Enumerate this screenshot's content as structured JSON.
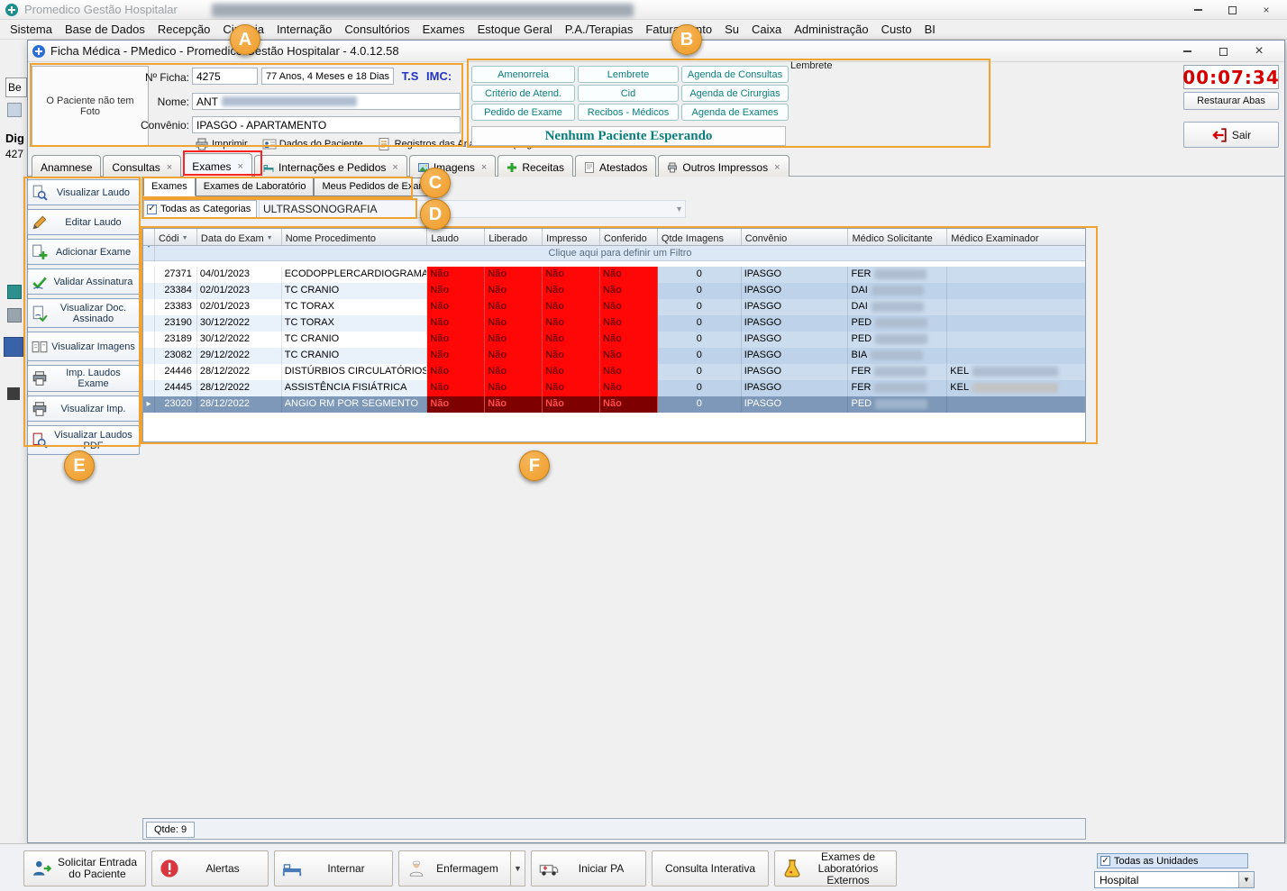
{
  "colors": {
    "accent_orange": "#F0A232",
    "annot_red": "#FF2222",
    "no_bg": "#FF0707",
    "no_text": "#7A0000",
    "sel_no_bg": "#7E0000",
    "sel_no_text": "#FF4A4A",
    "timer_red": "#D40000",
    "teal": "#0A7D7D",
    "row_right": "#CCDCEF",
    "row_alt_left": "#E9F1FA",
    "row_alt_right": "#BED3EA",
    "row_selected": "#7D98B8"
  },
  "icons": {
    "close": "×",
    "tab_close": "×",
    "dropdown_arrow": "▾",
    "sort_desc": "▼",
    "row_pointer": "▸",
    "check": "✓"
  },
  "main_window": {
    "title": "Promedico Gestão Hospitalar",
    "menu_items": [
      "Sistema",
      "Base de Dados",
      "Recepção",
      "Cirurgia",
      "Internação",
      "Consultórios",
      "Exames",
      "Estoque Geral",
      "P.A./Terapias",
      "Faturamento",
      "Su",
      "Caixa",
      "Administração",
      "Custo",
      "BI"
    ]
  },
  "leftover": {
    "tab": "Be",
    "line1": "Dig",
    "line2": "427"
  },
  "ficha_window": {
    "title": "Ficha Médica - PMedico - Promedico Gestão Hospitalar - 4.0.12.58",
    "photo_placeholder": "O Paciente não tem Foto",
    "ficha_label": "Nº Ficha:",
    "ficha_value": "4275",
    "age_text": "77 Anos, 4 Meses e 18 Dias",
    "ts_label": "T.S",
    "imc_label": "IMC:",
    "nome_label": "Nome:",
    "nome_value": "ANT",
    "convenio_label": "Convênio:",
    "convenio_value": "IPASGO - APARTAMENTO",
    "links": [
      "Imprimir",
      "Dados do Paciente",
      "Registros das Anamneses (Log"
    ],
    "action_buttons": [
      "Amenorreia",
      "Lembrete",
      "Agenda de Consultas",
      "Critério de Atend.",
      "Cid",
      "Agenda de Cirurgias",
      "Pedido de Exame",
      "Recibos - Médicos",
      "Agenda de Exames"
    ],
    "waiting_banner": "Nenhum Paciente Esperando",
    "lembrete_group_label": "Lembrete",
    "timer": "00:07:34",
    "restore_tabs": "Restaurar Abas",
    "exit": "Sair"
  },
  "tabs": {
    "items": [
      "Anamnese",
      "Consultas",
      "Exames",
      "Internações e Pedidos",
      "Imagens",
      "Receitas",
      "Atestados",
      "Outros Impressos"
    ]
  },
  "subtabs": {
    "items": [
      "Exames",
      "Exames de Laboratório",
      "Meus Pedidos de Exame"
    ]
  },
  "category": {
    "checkbox_label": "Todas as Categorias",
    "checked": true,
    "value": "ULTRASSONOGRAFIA"
  },
  "sidebar": {
    "buttons": [
      "Visualizar Laudo",
      "Editar Laudo",
      "Adicionar Exame",
      "Validar Assinatura",
      "Visualizar Doc. Assinado",
      "Visualizar Imagens",
      "Imp. Laudos Exame",
      "Visualizar Imp.",
      "Visualizar Laudos PDF"
    ]
  },
  "grid": {
    "columns": [
      "Códi",
      "Data do Exam",
      "Nome Procedimento",
      "Laudo",
      "Liberado",
      "Impresso",
      "Conferido",
      "Qtde Imagens",
      "Convênio",
      "Médico Solicitante",
      "Médico Examinador"
    ],
    "filter_text": "Clique aqui para definir um Filtro",
    "rows": [
      {
        "codigo": "27371",
        "data": "04/01/2023",
        "nome": "ECODOPPLERCARDIOGRAMA",
        "laudo": "Não",
        "liberado": "Não",
        "impresso": "Não",
        "conferido": "Não",
        "qtde": "0",
        "convenio": "IPASGO",
        "solicitante": "FER",
        "examinador": ""
      },
      {
        "codigo": "23384",
        "data": "02/01/2023",
        "nome": "TC CRANIO",
        "laudo": "Não",
        "liberado": "Não",
        "impresso": "Não",
        "conferido": "Não",
        "qtde": "0",
        "convenio": "IPASGO",
        "solicitante": "DAI",
        "examinador": ""
      },
      {
        "codigo": "23383",
        "data": "02/01/2023",
        "nome": "TC TORAX",
        "laudo": "Não",
        "liberado": "Não",
        "impresso": "Não",
        "conferido": "Não",
        "qtde": "0",
        "convenio": "IPASGO",
        "solicitante": "DAI",
        "examinador": ""
      },
      {
        "codigo": "23190",
        "data": "30/12/2022",
        "nome": "TC TORAX",
        "laudo": "Não",
        "liberado": "Não",
        "impresso": "Não",
        "conferido": "Não",
        "qtde": "0",
        "convenio": "IPASGO",
        "solicitante": "PED",
        "examinador": ""
      },
      {
        "codigo": "23189",
        "data": "30/12/2022",
        "nome": "TC CRANIO",
        "laudo": "Não",
        "liberado": "Não",
        "impresso": "Não",
        "conferido": "Não",
        "qtde": "0",
        "convenio": "IPASGO",
        "solicitante": "PED",
        "examinador": ""
      },
      {
        "codigo": "23082",
        "data": "29/12/2022",
        "nome": "TC CRANIO",
        "laudo": "Não",
        "liberado": "Não",
        "impresso": "Não",
        "conferido": "Não",
        "qtde": "0",
        "convenio": "IPASGO",
        "solicitante": "BIA",
        "examinador": ""
      },
      {
        "codigo": "24446",
        "data": "28/12/2022",
        "nome": "DISTÚRBIOS CIRCULATÓRIOS",
        "laudo": "Não",
        "liberado": "Não",
        "impresso": "Não",
        "conferido": "Não",
        "qtde": "0",
        "convenio": "IPASGO",
        "solicitante": "FER",
        "examinador": "KEL"
      },
      {
        "codigo": "24445",
        "data": "28/12/2022",
        "nome": "ASSISTÊNCIA FISIÁTRICA",
        "laudo": "Não",
        "liberado": "Não",
        "impresso": "Não",
        "conferido": "Não",
        "qtde": "0",
        "convenio": "IPASGO",
        "solicitante": "FER",
        "examinador": "KEL"
      },
      {
        "codigo": "23020",
        "data": "28/12/2022",
        "nome": "ANGIO RM POR SEGMENTO",
        "laudo": "Não",
        "liberado": "Não",
        "impresso": "Não",
        "conferido": "Não",
        "qtde": "0",
        "convenio": "IPASGO",
        "solicitante": "PED",
        "examinador": ""
      }
    ],
    "status": "Qtde: 9"
  },
  "bottom_toolbar": {
    "buttons": [
      "Solicitar Entrada do Paciente",
      "Alertas",
      "Internar",
      "Enfermagem",
      "Iniciar PA",
      "Consulta Interativa",
      "Exames de Laboratórios Externos"
    ],
    "units_checkbox_label": "Todas as Unidades",
    "unit_value": "Hospital"
  },
  "annotations": {
    "labels": [
      "A",
      "B",
      "C",
      "D",
      "E",
      "F"
    ]
  }
}
